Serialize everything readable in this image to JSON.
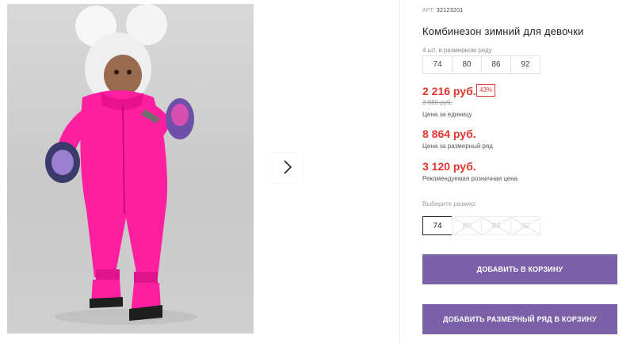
{
  "gallery": {
    "photo_alt": "winter-jumpsuit-photo",
    "next_icon": "chevron-right-icon"
  },
  "product": {
    "article_label": "АРТ.",
    "article_value": "32123201",
    "title": "Комбинезон зимний для девочки",
    "pack_note": "4 шт. в размерном ряду",
    "pack_sizes": [
      "74",
      "80",
      "86",
      "92"
    ],
    "price": "2 216 руб.",
    "discount": "43%",
    "old_price": "3 880 руб.",
    "price_unit_label": "Цена за единицу",
    "pack_price": "8 864 руб.",
    "pack_price_label": "Цена за размерный ряд",
    "rrp_price": "3 120 руб.",
    "rrp_label": "Рекомендуемая розничная цена",
    "choose_size_label": "Выберите размер:",
    "size_options": [
      {
        "label": "74",
        "state": "selected"
      },
      {
        "label": "80",
        "state": "unavailable"
      },
      {
        "label": "86",
        "state": "unavailable"
      },
      {
        "label": "92",
        "state": "unavailable"
      }
    ]
  },
  "actions": {
    "add_to_cart": "ДОБАВИТЬ В КОРЗИНУ",
    "add_pack_to_cart": "ДОБАВИТЬ РАЗМЕРНЫЙ РЯД В КОРЗИНУ"
  },
  "colors": {
    "accent_red": "#e3342f",
    "button_purple": "#7b62a8",
    "suit_pink": "#ff1fa0"
  }
}
